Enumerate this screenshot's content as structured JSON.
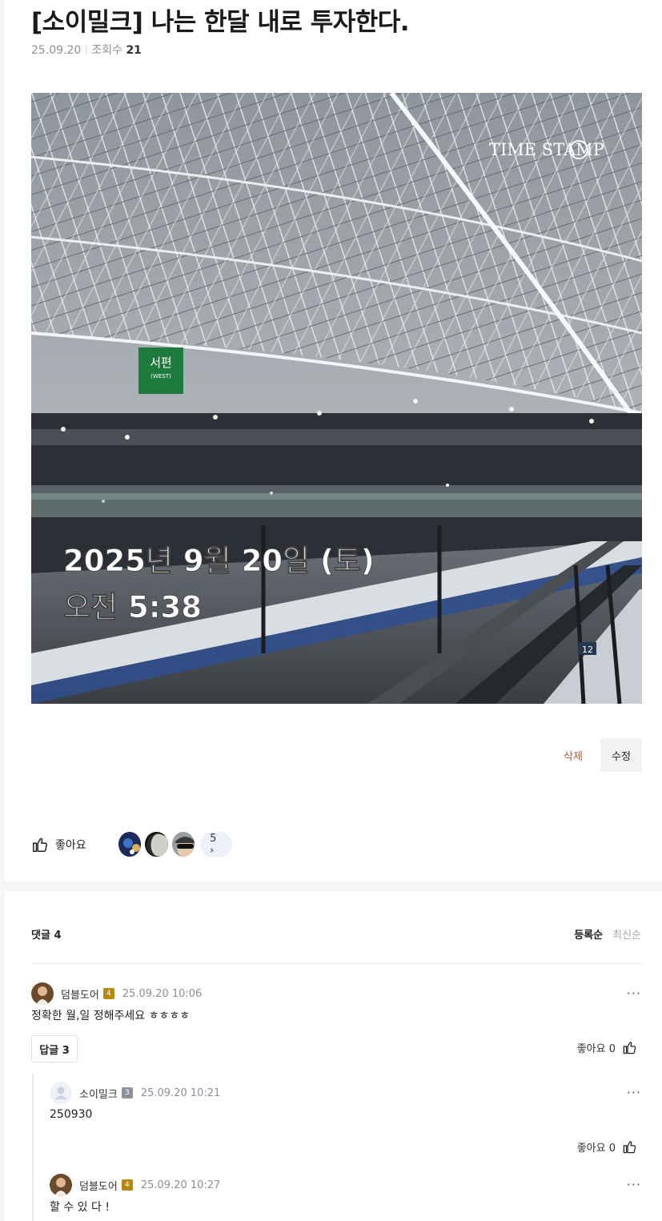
{
  "post": {
    "title": "[소이밀크] 나는 한달 내로 투자한다.",
    "date": "25.09.20",
    "views_label": "조회수",
    "views": "21"
  },
  "photo": {
    "sign_text": "서편",
    "sign_sub": "(WEST)",
    "watermark": "TIME STAMP",
    "stamp_date": "2025년 9월 20일 (토)",
    "stamp_time": "오전 5:38",
    "platform_number": "12"
  },
  "actions": {
    "delete_label": "삭제",
    "edit_label": "수정"
  },
  "likes": {
    "label": "좋아요",
    "count_label": "5 ›"
  },
  "comments": {
    "header": "댓글 4",
    "sort_registered": "등록순",
    "sort_latest": "최신순",
    "more_label": "···",
    "items": [
      {
        "author": "덤블도어",
        "level": "4",
        "time": "25.09.20 10:06",
        "text": "정확한 월,일 정해주세요 ㅎㅎㅎㅎ",
        "reply_label": "답글 3",
        "like_label": "좋아요 0"
      },
      {
        "author": "소이밀크",
        "level": "3",
        "time": "25.09.20 10:21",
        "text": "250930",
        "like_label": "좋아요 0"
      },
      {
        "author": "덤블도어",
        "level": "4",
        "time": "25.09.20 10:27",
        "text": "할 수 있 다 !"
      }
    ]
  },
  "colors": {
    "delete": "#c0532e",
    "badge_gold": "#b48a12",
    "badge_gray": "#8c929c",
    "like_pill": "#eef1fb"
  }
}
